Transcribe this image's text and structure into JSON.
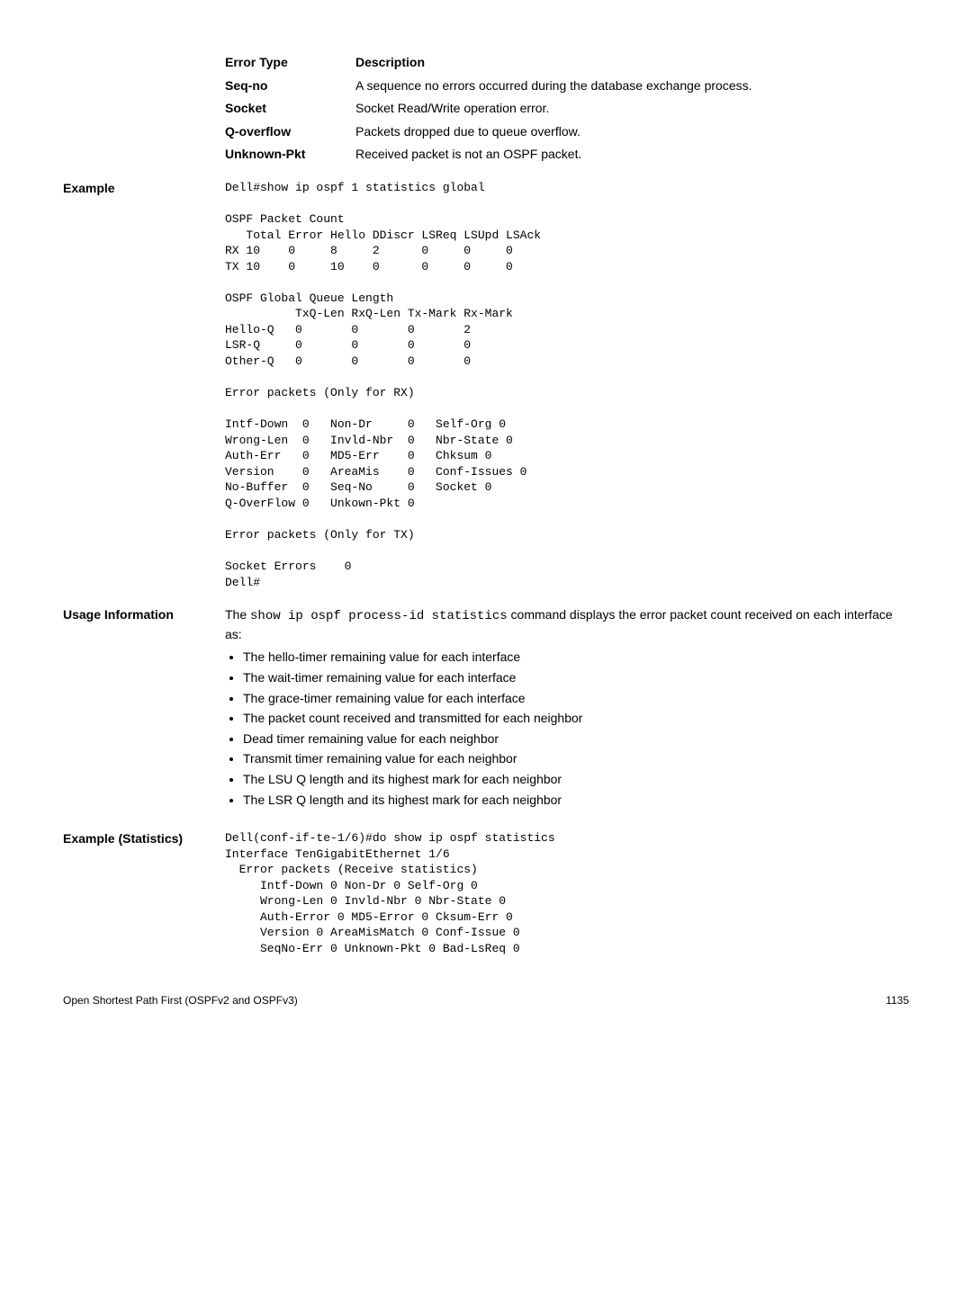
{
  "errorTable": {
    "header": {
      "col1": "Error Type",
      "col2": "Description"
    },
    "rows": [
      {
        "type": "Seq-no",
        "desc": "A sequence no errors occurred during the database exchange process."
      },
      {
        "type": "Socket",
        "desc": "Socket Read/Write operation error."
      },
      {
        "type": "Q-overflow",
        "desc": "Packets dropped due to queue overflow."
      },
      {
        "type": "Unknown-Pkt",
        "desc": "Received packet is not an OSPF packet."
      }
    ]
  },
  "example1": {
    "label": "Example",
    "cli": "Dell#show ip ospf 1 statistics global\n\nOSPF Packet Count\n   Total Error Hello DDiscr LSReq LSUpd LSAck\nRX 10    0     8     2      0     0     0\nTX 10    0     10    0      0     0     0\n\nOSPF Global Queue Length\n          TxQ-Len RxQ-Len Tx-Mark Rx-Mark\nHello-Q   0       0       0       2\nLSR-Q     0       0       0       0\nOther-Q   0       0       0       0\n\nError packets (Only for RX)\n\nIntf-Down  0   Non-Dr     0   Self-Org 0\nWrong-Len  0   Invld-Nbr  0   Nbr-State 0\nAuth-Err   0   MD5-Err    0   Chksum 0\nVersion    0   AreaMis    0   Conf-Issues 0\nNo-Buffer  0   Seq-No     0   Socket 0\nQ-OverFlow 0   Unkown-Pkt 0\n\nError packets (Only for TX)\n\nSocket Errors    0\nDell#"
  },
  "usage": {
    "label": "Usage Information",
    "intro_pre": "The ",
    "intro_code": "show ip ospf process-id statistics",
    "intro_post": " command displays the error packet count received on each interface as:",
    "bullets": [
      "The hello-timer remaining value for each interface",
      "The wait-timer remaining value for each interface",
      "The grace-timer remaining value for each interface",
      "The packet count received and transmitted for each neighbor",
      "Dead timer remaining value for each neighbor",
      "Transmit timer remaining value for each neighbor",
      "The LSU Q length and its highest mark for each neighbor",
      "The LSR Q length and its highest mark for each neighbor"
    ]
  },
  "example2": {
    "label": "Example (Statistics)",
    "cli": "Dell(conf-if-te-1/6)#do show ip ospf statistics\nInterface TenGigabitEthernet 1/6\n  Error packets (Receive statistics)\n     Intf-Down 0 Non-Dr 0 Self-Org 0\n     Wrong-Len 0 Invld-Nbr 0 Nbr-State 0\n     Auth-Error 0 MD5-Error 0 Cksum-Err 0\n     Version 0 AreaMisMatch 0 Conf-Issue 0\n     SeqNo-Err 0 Unknown-Pkt 0 Bad-LsReq 0"
  },
  "footer": {
    "left": "Open Shortest Path First (OSPFv2 and OSPFv3)",
    "right": "1135"
  }
}
